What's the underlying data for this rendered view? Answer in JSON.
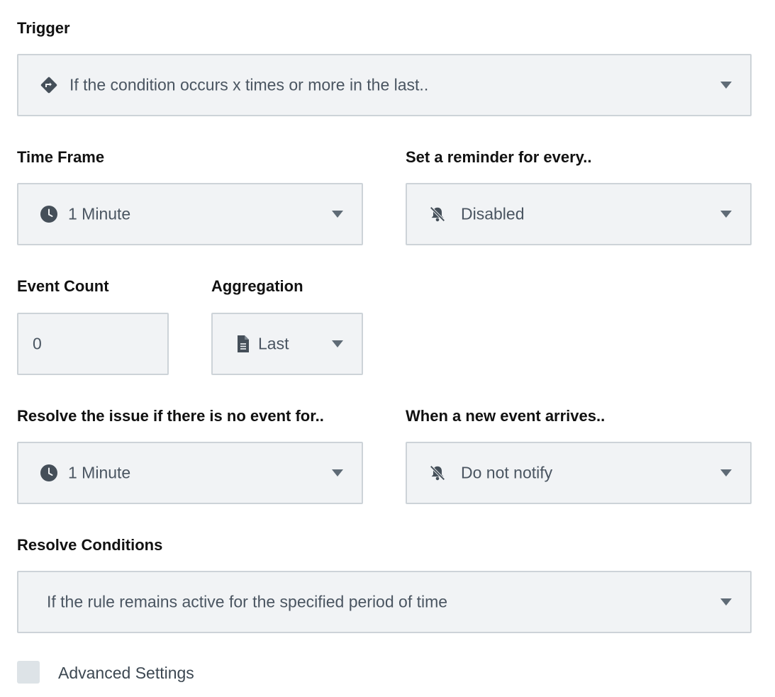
{
  "trigger": {
    "label": "Trigger",
    "value": "If the condition occurs x times or more in the last..",
    "icon": "direction-diamond-icon"
  },
  "time_frame": {
    "label": "Time Frame",
    "value": "1 Minute",
    "icon": "clock-icon"
  },
  "reminder": {
    "label": "Set a reminder for every..",
    "value": "Disabled",
    "icon": "bell-off-icon"
  },
  "event_count": {
    "label": "Event Count",
    "value": "0"
  },
  "aggregation": {
    "label": "Aggregation",
    "value": "Last",
    "icon": "document-icon"
  },
  "resolve_timeout": {
    "label": "Resolve the issue if there is no event for..",
    "value": "1 Minute",
    "icon": "clock-icon"
  },
  "new_event": {
    "label": "When a new event arrives..",
    "value": "Do not notify",
    "icon": "bell-off-icon"
  },
  "resolve_conditions": {
    "label": "Resolve Conditions",
    "value": "If the rule remains active for the specified period of time"
  },
  "advanced_settings": {
    "label": "Advanced Settings",
    "checked": false
  },
  "colors": {
    "field_bg": "#f1f3f5",
    "field_border": "#cdd3d8",
    "icon": "#454f59",
    "text": "#4a5561"
  }
}
